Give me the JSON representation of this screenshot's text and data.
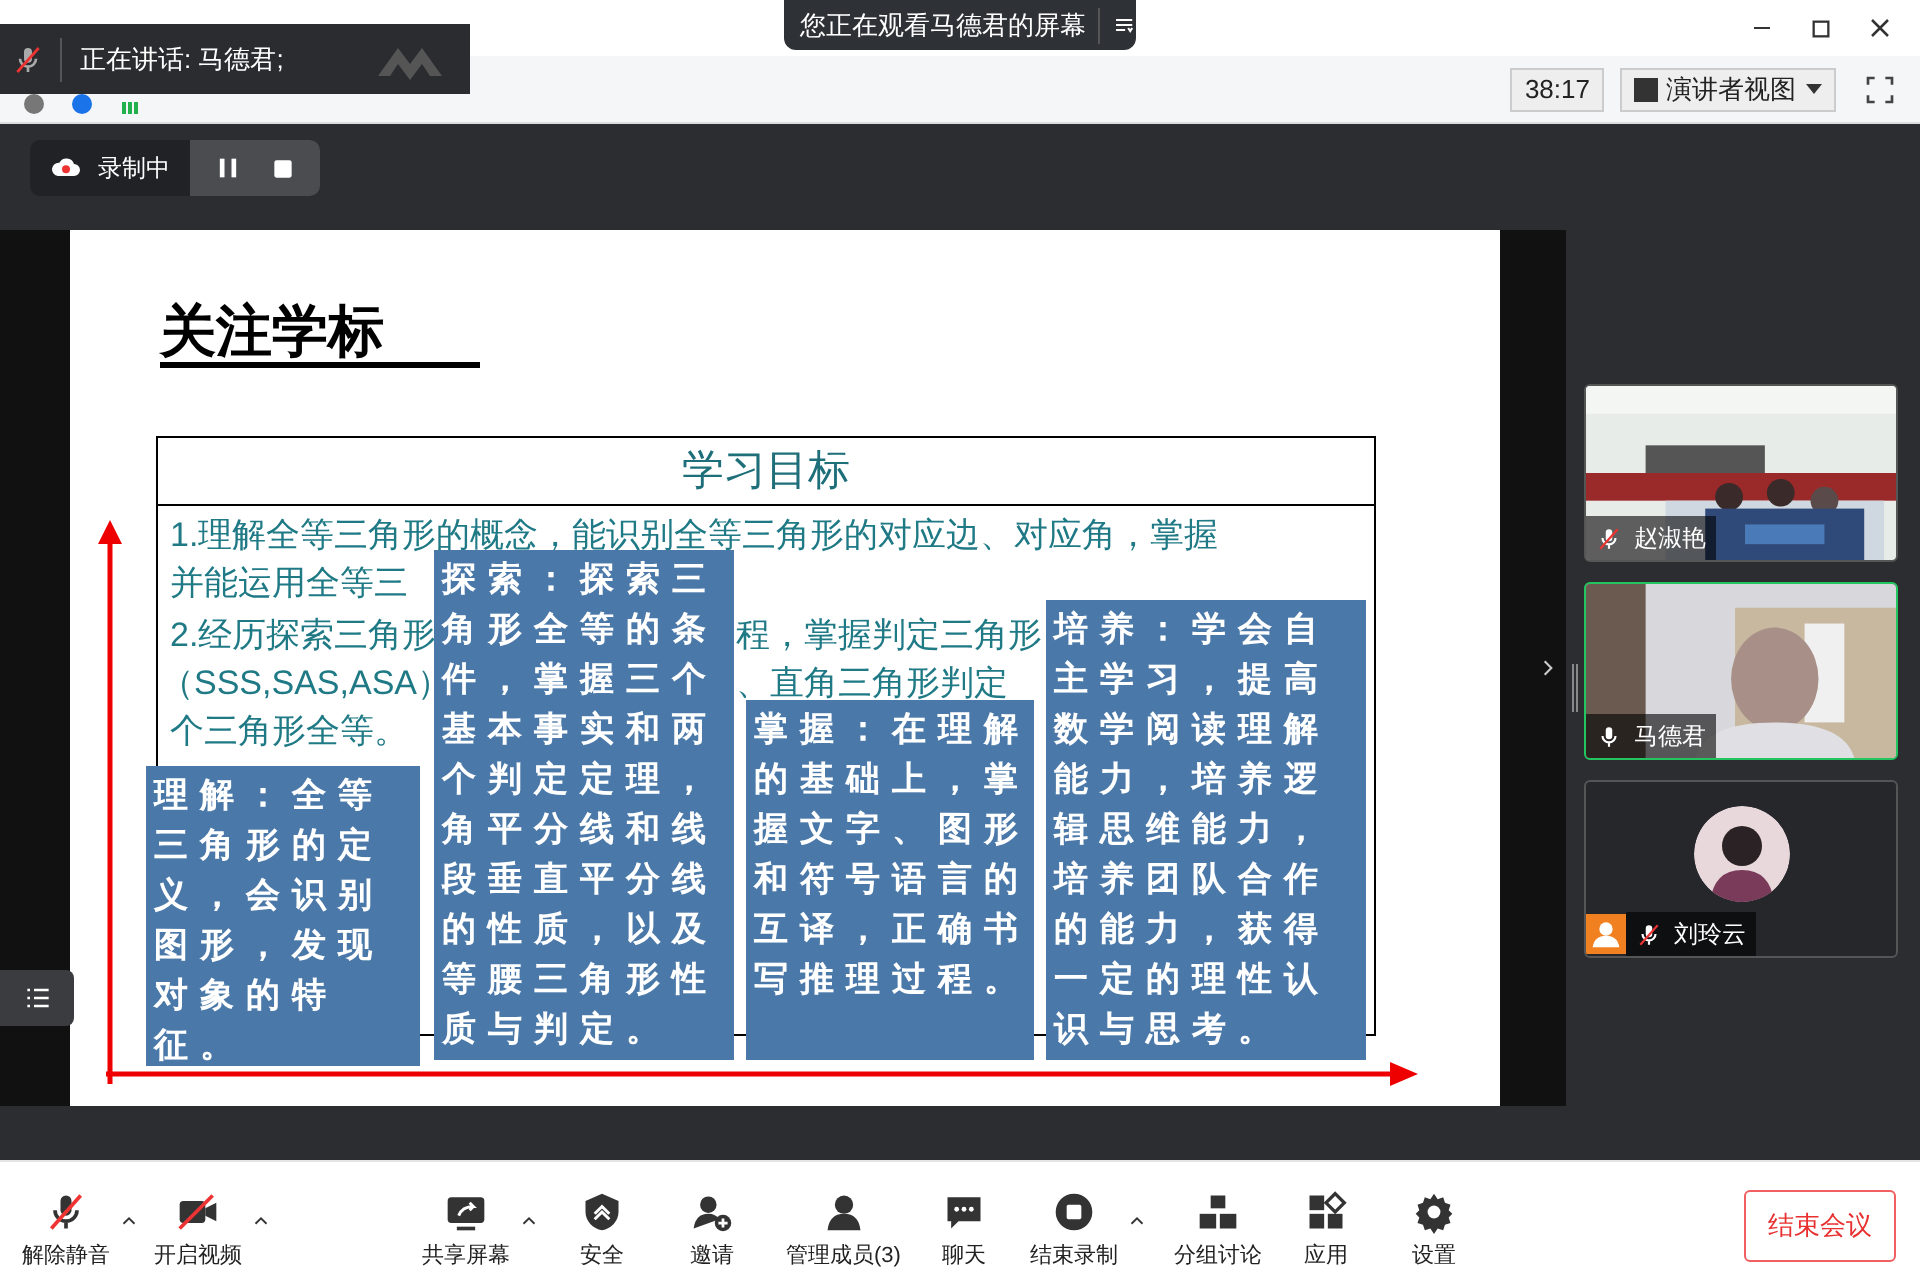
{
  "window": {
    "banner": "您正在观看马德君的屏幕"
  },
  "speaking": {
    "label": "正在讲话: 马德君;"
  },
  "top_bar": {
    "timer": "38:17",
    "view_button": "演讲者视图"
  },
  "recording": {
    "label": "录制中"
  },
  "slide": {
    "title": "关注学标",
    "table_header": "学习目标",
    "fragments": [
      {
        "text": "1.理解全等三角形的概念，能识别全等三角形的对应边、对应角，掌握",
        "kind": "under"
      },
      {
        "text": "并能运用全等三",
        "kind": "under"
      },
      {
        "text": "2.经历探索三角形",
        "kind": "under"
      },
      {
        "text": "程，掌握判定三角形",
        "kind": "under"
      },
      {
        "text": "（SSS,SAS,ASA）",
        "kind": "under"
      },
      {
        "text": "、直角三角形判定",
        "kind": "under"
      },
      {
        "text": "个三角形全等。",
        "kind": "under"
      }
    ],
    "boxes": [
      "理解：全等三角形的定义，会识别图形，发现对象的特征。",
      "探索：探索三角形全等的条件，掌握三个基本事实和两个判定定理，角平分线和线段垂直平分线的性质，以及等腰三角形性质与判定。",
      "掌握：在理解的基础上，掌握文字、图形和符号语言的互译，正确书写推理过程。",
      "培养：学会自主学习，提高数学阅读理解能力，培养逻辑思维能力，培养团队合作的能力，获得一定的理性认识与思考。"
    ]
  },
  "participants": [
    {
      "name": "赵淑艳",
      "kind": "video",
      "muted": true,
      "selected": false
    },
    {
      "name": "马德君",
      "kind": "video",
      "muted": false,
      "selected": true
    },
    {
      "name": "刘玲云",
      "kind": "avatar",
      "muted": true,
      "selected": false
    }
  ],
  "toolbar": [
    {
      "label": "解除静音",
      "menu": true
    },
    {
      "label": "开启视频",
      "menu": true
    },
    {
      "label": "共享屏幕",
      "menu": true
    },
    {
      "label": "安全",
      "menu": false
    },
    {
      "label": "邀请",
      "menu": false
    },
    {
      "label": "管理成员(3)",
      "menu": false
    },
    {
      "label": "聊天",
      "menu": false
    },
    {
      "label": "结束录制",
      "menu": true
    },
    {
      "label": "分组讨论",
      "menu": false
    },
    {
      "label": "应用",
      "menu": false
    },
    {
      "label": "设置",
      "menu": false
    }
  ],
  "end_button": "结束会议"
}
